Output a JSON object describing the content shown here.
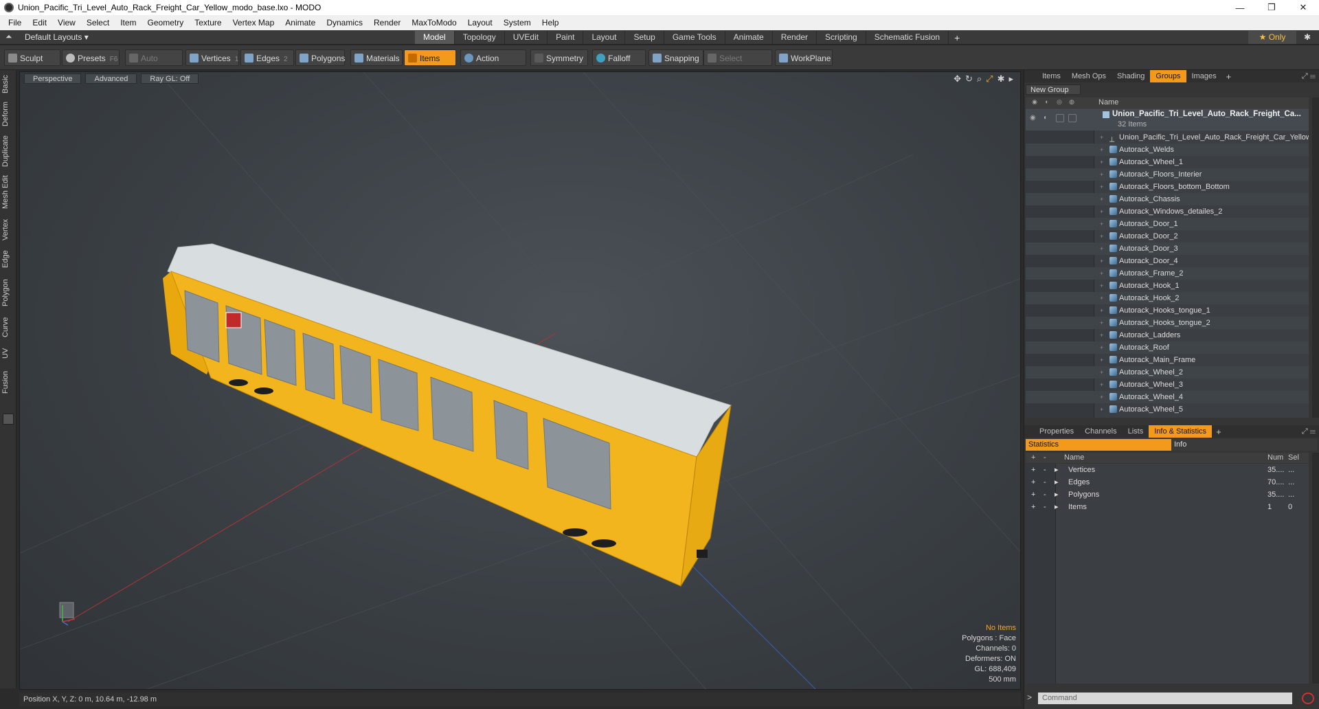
{
  "window": {
    "title": "Union_Pacific_Tri_Level_Auto_Rack_Freight_Car_Yellow_modo_base.lxo - MODO",
    "min": "—",
    "max": "❐",
    "close": "✕"
  },
  "menu": [
    "File",
    "Edit",
    "View",
    "Select",
    "Item",
    "Geometry",
    "Texture",
    "Vertex Map",
    "Animate",
    "Dynamics",
    "Render",
    "MaxToModo",
    "Layout",
    "System",
    "Help"
  ],
  "layoutbar": {
    "layout_label": "Default Layouts ▾",
    "tabs": [
      "Model",
      "Topology",
      "UVEdit",
      "Paint",
      "Layout",
      "Setup",
      "Game Tools",
      "Animate",
      "Render",
      "Scripting",
      "Schematic Fusion"
    ],
    "active_tab": "Model",
    "only_label": "★  Only"
  },
  "toolbar": {
    "sculpt": "Sculpt",
    "presets": "Presets",
    "presets_key": "F6",
    "auto_select": "Auto Select",
    "vertices": "Vertices",
    "vertices_count": "1",
    "edges": "Edges",
    "edges_count": "2",
    "polygons": "Polygons",
    "materials": "Materials",
    "items": "Items",
    "action_center": "Action Center",
    "symmetry": "Symmetry",
    "falloff": "Falloff",
    "snapping": "Snapping",
    "select_through": "Select Through",
    "workplane": "WorkPlane"
  },
  "left_tabs": [
    "Basic",
    "Deform",
    "Duplicate",
    "Mesh Edit",
    "Vertex",
    "Edge",
    "Polygon",
    "Curve",
    "UV",
    "Fusion"
  ],
  "viewport": {
    "tabs": [
      "Perspective",
      "Advanced",
      "Ray GL: Off"
    ],
    "info": {
      "no_items": "No Items",
      "polygons": "Polygons : Face",
      "channels": "Channels: 0",
      "deformers": "Deformers: ON",
      "gl": "GL: 688,409",
      "scale": "500 mm"
    }
  },
  "status": {
    "position": "Position X, Y, Z:  0 m, 10.64 m, -12.98 m"
  },
  "right_top": {
    "tabs": [
      "Items",
      "Mesh Ops",
      "Shading",
      "Groups",
      "Images"
    ],
    "active_tab": "Groups",
    "new_group": "New Group",
    "col_name": "Name",
    "group_name": "Union_Pacific_Tri_Level_Auto_Rack_Freight_Ca...",
    "group_count": "32 Items",
    "items": [
      "Union_Pacific_Tri_Level_Auto_Rack_Freight_Car_Yellow",
      "Autorack_Welds",
      "Autorack_Wheel_1",
      "Autorack_Floors_Interier",
      "Autorack_Floors_bottom_Bottom",
      "Autorack_Chassis",
      "Autorack_Windows_detailes_2",
      "Autorack_Door_1",
      "Autorack_Door_2",
      "Autorack_Door_3",
      "Autorack_Door_4",
      "Autorack_Frame_2",
      "Autorack_Hook_1",
      "Autorack_Hook_2",
      "Autorack_Hooks_tongue_1",
      "Autorack_Hooks_tongue_2",
      "Autorack_Ladders",
      "Autorack_Roof",
      "Autorack_Main_Frame",
      "Autorack_Wheel_2",
      "Autorack_Wheel_3",
      "Autorack_Wheel_4",
      "Autorack_Wheel_5"
    ]
  },
  "right_bottom": {
    "tabs": [
      "Properties",
      "Channels",
      "Lists",
      "Info & Statistics"
    ],
    "active_tab": "Info & Statistics",
    "sub_tabs": [
      "Statistics",
      "Info"
    ],
    "col_name": "Name",
    "col_num": "Num",
    "col_sel": "Sel",
    "rows": [
      {
        "name": "Vertices",
        "num": "35....",
        "sel": "..."
      },
      {
        "name": "Edges",
        "num": "70....",
        "sel": "..."
      },
      {
        "name": "Polygons",
        "num": "35....",
        "sel": "..."
      },
      {
        "name": "Items",
        "num": "1",
        "sel": "0"
      }
    ],
    "command_placeholder": "Command",
    "prompt": ">"
  },
  "colors": {
    "accent": "#f39a1c",
    "car_yellow": "#f2b51d",
    "roof": "#d8dde0"
  }
}
